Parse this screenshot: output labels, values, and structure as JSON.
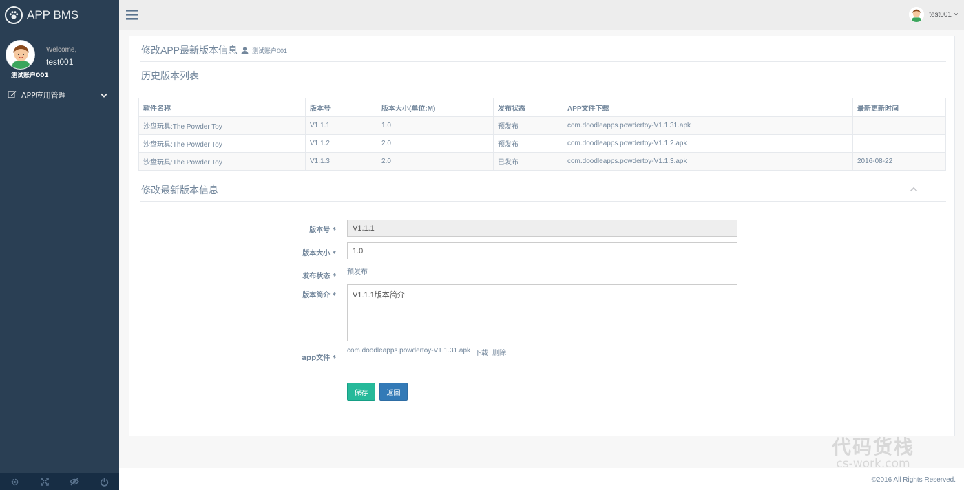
{
  "brand": {
    "title": "APP BMS"
  },
  "profile": {
    "welcome": "Welcome,",
    "username": "test001",
    "account": "测试账户001"
  },
  "sidebar": {
    "items": [
      {
        "label": "APP应用管理",
        "icon": "edit-icon"
      }
    ]
  },
  "topnav": {
    "username": "test001"
  },
  "panel": {
    "title": "修改APP最新版本信息",
    "subtitle": "测试账户001"
  },
  "history": {
    "title": "历史版本列表",
    "columns": [
      "软件名称",
      "版本号",
      "版本大小(单位:M)",
      "发布状态",
      "APP文件下载",
      "最新更新时间"
    ],
    "rows": [
      [
        "沙盘玩具:The Powder Toy",
        "V1.1.1",
        "1.0",
        "预发布",
        "com.doodleapps.powdertoy-V1.1.31.apk",
        ""
      ],
      [
        "沙盘玩具:The Powder Toy",
        "V1.1.2",
        "2.0",
        "预发布",
        "com.doodleapps.powdertoy-V1.1.2.apk",
        ""
      ],
      [
        "沙盘玩具:The Powder Toy",
        "V1.1.3",
        "2.0",
        "已发布",
        "com.doodleapps.powdertoy-V1.1.3.apk",
        "2016-08-22"
      ]
    ]
  },
  "form": {
    "title": "修改最新版本信息",
    "version_label": "版本号 *",
    "version_value": "V1.1.1",
    "size_label": "版本大小 *",
    "size_value": "1.0",
    "status_label": "发布状态 *",
    "status_value": "预发布",
    "intro_label": "版本简介 *",
    "intro_value": "V1.1.1版本简介",
    "file_label": "app文件 *",
    "file_name": "com.doodleapps.powdertoy-V1.1.31.apk",
    "download_label": "下载",
    "delete_label": "删除",
    "save_label": "保存",
    "back_label": "返回"
  },
  "footer": {
    "copyright": "©2016 All Rights Reserved."
  },
  "watermark": {
    "line1": "代码货栈",
    "line2": "cs-work.com"
  },
  "colors": {
    "sidebar": "#2A3F54",
    "save": "#26B99A",
    "back": "#337AB7"
  }
}
